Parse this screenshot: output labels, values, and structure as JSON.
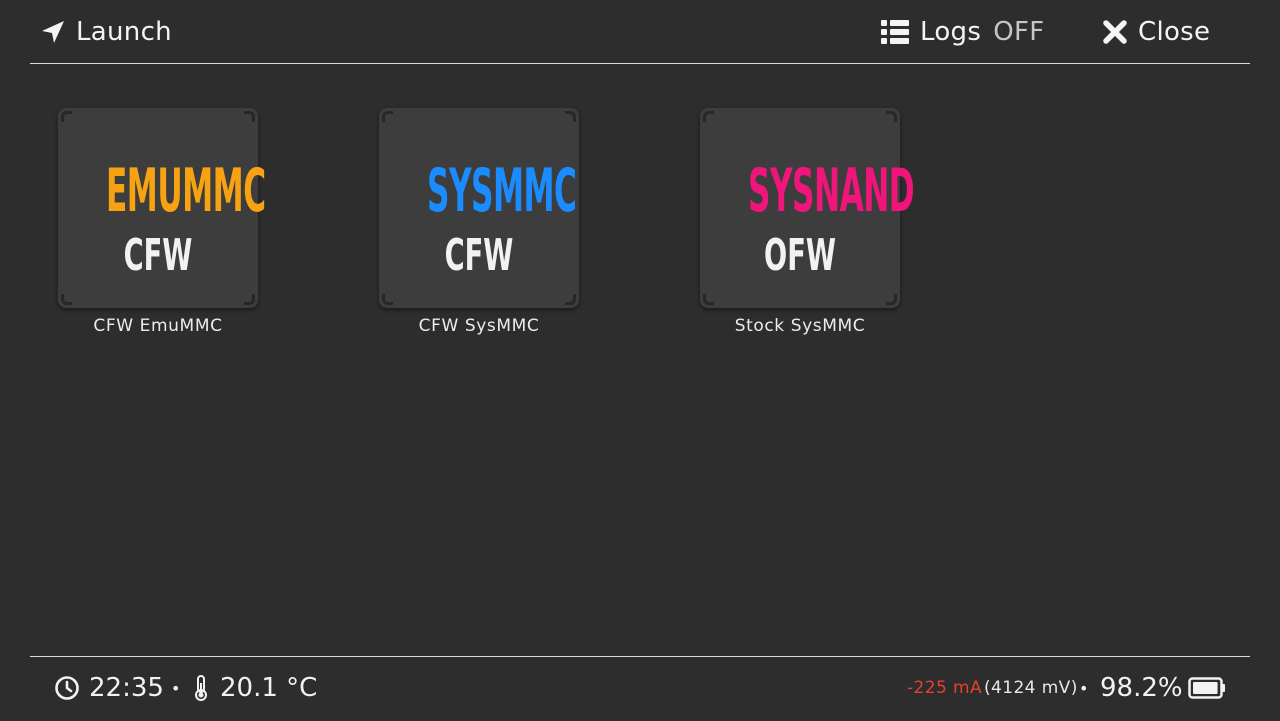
{
  "header": {
    "launch_label": "Launch",
    "logs_label": "Logs",
    "logs_state": "OFF",
    "close_label": "Close"
  },
  "tiles": [
    {
      "title": "EMUMMC",
      "subtitle": "CFW",
      "caption": "CFW EmuMMC",
      "title_color": "#f7a213"
    },
    {
      "title": "SYSMMC",
      "subtitle": "CFW",
      "caption": "CFW SysMMC",
      "title_color": "#1a8cff"
    },
    {
      "title": "SYSNAND",
      "subtitle": "OFW",
      "caption": "Stock SysMMC",
      "title_color": "#f0157a"
    }
  ],
  "footer": {
    "time": "22:35",
    "separator": "•",
    "temperature": "20.1 °C",
    "current": "-225 mA",
    "voltage": "(4124 mV)",
    "battery_percent": "98.2%",
    "battery_level": 0.982
  },
  "colors": {
    "background": "#2d2d2d",
    "tile": "#3d3d3d",
    "current_text": "#e5412d"
  },
  "icons": {
    "launch": "location-arrow-icon",
    "logs": "list-icon",
    "close": "close-icon",
    "clock": "clock-icon",
    "thermometer": "thermometer-icon",
    "battery": "battery-icon"
  }
}
